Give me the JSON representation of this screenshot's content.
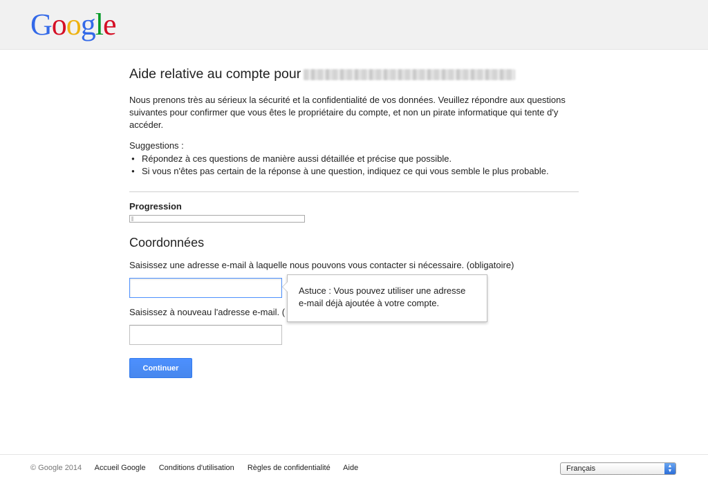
{
  "header": {
    "logo_letters": [
      {
        "char": "G",
        "color": "#3369e8"
      },
      {
        "char": "o",
        "color": "#d50f25"
      },
      {
        "char": "o",
        "color": "#eeb211"
      },
      {
        "char": "g",
        "color": "#3369e8"
      },
      {
        "char": "l",
        "color": "#009925"
      },
      {
        "char": "e",
        "color": "#d50f25"
      }
    ]
  },
  "main": {
    "title": "Aide relative au compte pour",
    "intro": "Nous prenons très au sérieux la sécurité et la confidentialité de vos données. Veuillez répondre aux questions suivantes pour confirmer que vous êtes le propriétaire du compte, et non un pirate informatique qui tente d'y accéder.",
    "suggestions_title": "Suggestions :",
    "suggestions": [
      "Répondez à ces questions de manière aussi détaillée et précise que possible.",
      "Si vous n'êtes pas certain de la réponse à une question, indiquez ce qui vous semble le plus probable."
    ],
    "progress": {
      "label": "Progression",
      "fraction": 0.01
    },
    "section_title": "Coordonnées",
    "email_label": "Saisissez une adresse e-mail à laquelle nous pouvons vous contacter si nécessaire. (obligatoire)",
    "email_value": "",
    "email_confirm_label": "Saisissez à nouveau l'adresse e-mail. (",
    "email_confirm_value": "",
    "tooltip": "Astuce : Vous pouvez utiliser une adresse e-mail déjà ajoutée à votre compte.",
    "continue_label": "Continuer"
  },
  "footer": {
    "copyright": "© Google  2014",
    "links": [
      "Accueil Google",
      "Conditions d'utilisation",
      "Règles de confidentialité",
      "Aide"
    ],
    "language": "Français"
  },
  "colors": {
    "accent": "#4d90fe",
    "header_bg": "#f1f1f1"
  }
}
